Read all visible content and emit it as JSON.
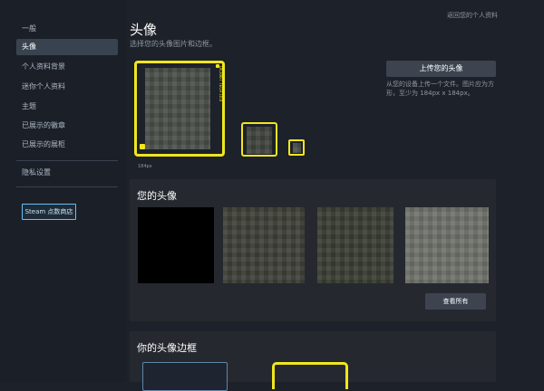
{
  "sidebar": {
    "items": [
      {
        "label": "一般"
      },
      {
        "label": "头像"
      },
      {
        "label": "个人资料背景"
      },
      {
        "label": "迷你个人资料"
      },
      {
        "label": "主题"
      },
      {
        "label": "已展示的徽章"
      },
      {
        "label": "已展示的展柜"
      },
      {
        "label": "隐私设置"
      }
    ],
    "store_button": "Steam 点数商店"
  },
  "header": {
    "back_link": "返回您的个人资料",
    "title": "头像",
    "subtitle": "选择您的头像图片和边框。"
  },
  "avatar_preview": {
    "size_label": "184px",
    "frame_tag": "DICRAFT TECH 10.0",
    "frame_color": "#f0e61f"
  },
  "upload": {
    "button": "上传您的头像",
    "hint": "从您的设备上传一个文件。图片应为方形，至少为 184px x 184px。"
  },
  "your_avatars": {
    "title": "您的头像",
    "view_all": "查看所有"
  },
  "your_frames": {
    "title": "你的头像边框"
  },
  "colors": {
    "background": "#1d2129",
    "panel": "#25292f",
    "button": "#3d4450",
    "accent_blue": "#66c0f4"
  }
}
